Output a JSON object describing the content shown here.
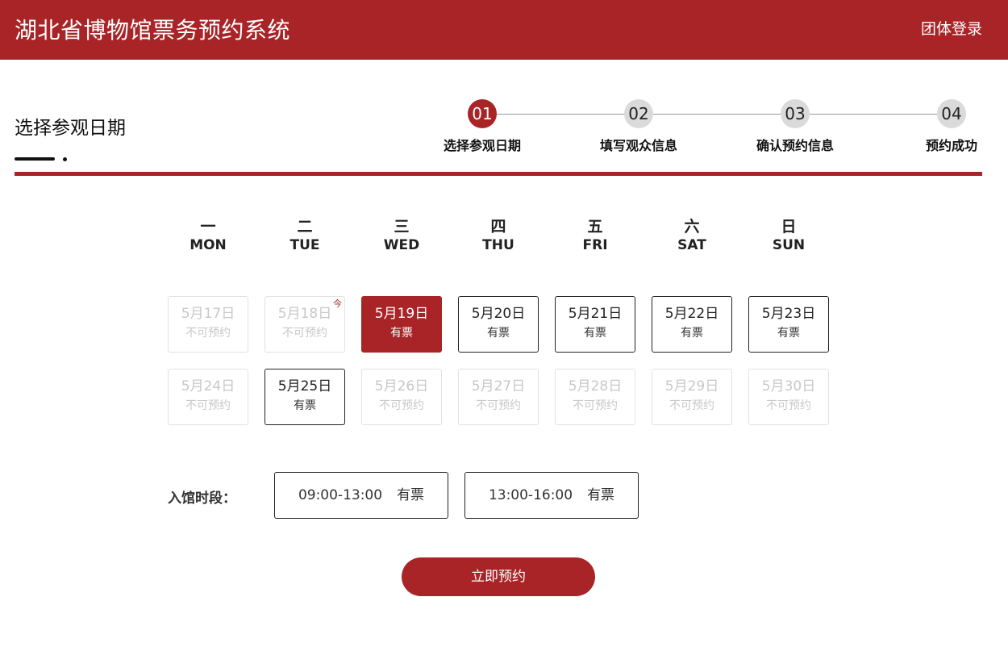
{
  "header": {
    "title": "湖北省博物馆票务预约系统",
    "login_label": "团体登录"
  },
  "section": {
    "title": "选择参观日期"
  },
  "steps": [
    {
      "num": "01",
      "label": "选择参观日期"
    },
    {
      "num": "02",
      "label": "填写观众信息"
    },
    {
      "num": "03",
      "label": "确认预约信息"
    },
    {
      "num": "04",
      "label": "预约成功"
    }
  ],
  "weekdays": [
    {
      "cn": "一",
      "en": "MON"
    },
    {
      "cn": "二",
      "en": "TUE"
    },
    {
      "cn": "三",
      "en": "WED"
    },
    {
      "cn": "四",
      "en": "THU"
    },
    {
      "cn": "五",
      "en": "FRI"
    },
    {
      "cn": "六",
      "en": "SAT"
    },
    {
      "cn": "日",
      "en": "SUN"
    }
  ],
  "calendar": {
    "today_mark": "今",
    "days": [
      {
        "date": "5月17日",
        "status": "不可预约"
      },
      {
        "date": "5月18日",
        "status": "不可预约"
      },
      {
        "date": "5月19日",
        "status": "有票"
      },
      {
        "date": "5月20日",
        "status": "有票"
      },
      {
        "date": "5月21日",
        "status": "有票"
      },
      {
        "date": "5月22日",
        "status": "有票"
      },
      {
        "date": "5月23日",
        "status": "有票"
      },
      {
        "date": "5月24日",
        "status": "不可预约"
      },
      {
        "date": "5月25日",
        "status": "有票"
      },
      {
        "date": "5月26日",
        "status": "不可预约"
      },
      {
        "date": "5月27日",
        "status": "不可预约"
      },
      {
        "date": "5月28日",
        "status": "不可预约"
      },
      {
        "date": "5月29日",
        "status": "不可预约"
      },
      {
        "date": "5月30日",
        "status": "不可预约"
      }
    ]
  },
  "time_slots": {
    "label": "入馆时段：",
    "slots": [
      {
        "time": "09:00-13:00",
        "status": "有票"
      },
      {
        "time": "13:00-16:00",
        "status": "有票"
      }
    ]
  },
  "submit_label": "立即预约",
  "colors": {
    "brand_red": "#a82427",
    "step_inactive": "#dadada",
    "disabled_text": "#c8c8c8"
  }
}
